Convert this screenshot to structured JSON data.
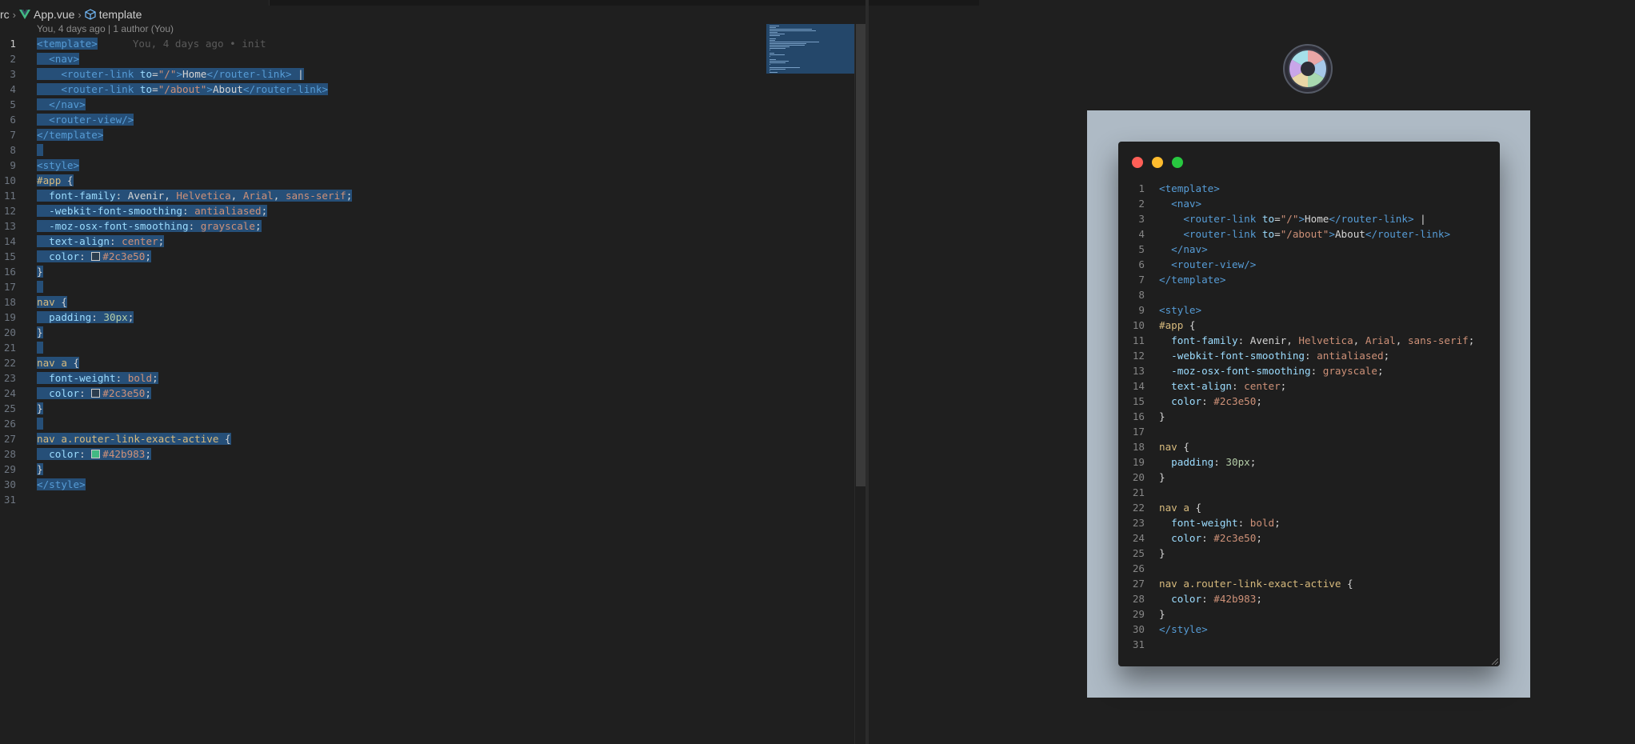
{
  "breadcrumbs": {
    "root": "rc",
    "file": "App.vue",
    "symbol": "template"
  },
  "blame": {
    "header": "You, 4 days ago | 1 author (You)",
    "inline": "You, 4 days ago • init"
  },
  "code_lines": [
    [
      {
        "t": "<template>",
        "c": "tag"
      }
    ],
    [
      {
        "t": "  ",
        "c": "text"
      },
      {
        "t": "<nav>",
        "c": "tag"
      }
    ],
    [
      {
        "t": "    ",
        "c": "text"
      },
      {
        "t": "<router-link ",
        "c": "tag"
      },
      {
        "t": "to",
        "c": "attr"
      },
      {
        "t": "=",
        "c": "punc"
      },
      {
        "t": "\"/\"",
        "c": "str"
      },
      {
        "t": ">",
        "c": "tag"
      },
      {
        "t": "Home",
        "c": "text"
      },
      {
        "t": "</router-link>",
        "c": "tag"
      },
      {
        "t": " |",
        "c": "text"
      }
    ],
    [
      {
        "t": "    ",
        "c": "text"
      },
      {
        "t": "<router-link ",
        "c": "tag"
      },
      {
        "t": "to",
        "c": "attr"
      },
      {
        "t": "=",
        "c": "punc"
      },
      {
        "t": "\"/about\"",
        "c": "str"
      },
      {
        "t": ">",
        "c": "tag"
      },
      {
        "t": "About",
        "c": "text"
      },
      {
        "t": "</router-link>",
        "c": "tag"
      }
    ],
    [
      {
        "t": "  ",
        "c": "text"
      },
      {
        "t": "</nav>",
        "c": "tag"
      }
    ],
    [
      {
        "t": "  ",
        "c": "text"
      },
      {
        "t": "<router-view/>",
        "c": "tag"
      }
    ],
    [
      {
        "t": "</template>",
        "c": "tag"
      }
    ],
    [],
    [
      {
        "t": "<style>",
        "c": "tag"
      }
    ],
    [
      {
        "t": "#app",
        "c": "sel"
      },
      {
        "t": " {",
        "c": "brace"
      }
    ],
    [
      {
        "t": "  ",
        "c": "text"
      },
      {
        "t": "font-family",
        "c": "attr"
      },
      {
        "t": ": ",
        "c": "punc"
      },
      {
        "t": "Avenir",
        "c": "text"
      },
      {
        "t": ", ",
        "c": "punc"
      },
      {
        "t": "Helvetica",
        "c": "str"
      },
      {
        "t": ", ",
        "c": "punc"
      },
      {
        "t": "Arial",
        "c": "str"
      },
      {
        "t": ", ",
        "c": "punc"
      },
      {
        "t": "sans-serif",
        "c": "str"
      },
      {
        "t": ";",
        "c": "punc"
      }
    ],
    [
      {
        "t": "  ",
        "c": "text"
      },
      {
        "t": "-webkit-font-smoothing",
        "c": "attr"
      },
      {
        "t": ": ",
        "c": "punc"
      },
      {
        "t": "antialiased",
        "c": "str"
      },
      {
        "t": ";",
        "c": "punc"
      }
    ],
    [
      {
        "t": "  ",
        "c": "text"
      },
      {
        "t": "-moz-osx-font-smoothing",
        "c": "attr"
      },
      {
        "t": ": ",
        "c": "punc"
      },
      {
        "t": "grayscale",
        "c": "str"
      },
      {
        "t": ";",
        "c": "punc"
      }
    ],
    [
      {
        "t": "  ",
        "c": "text"
      },
      {
        "t": "text-align",
        "c": "attr"
      },
      {
        "t": ": ",
        "c": "punc"
      },
      {
        "t": "center",
        "c": "str"
      },
      {
        "t": ";",
        "c": "punc"
      }
    ],
    [
      {
        "t": "  ",
        "c": "text"
      },
      {
        "t": "color",
        "c": "attr"
      },
      {
        "t": ": ",
        "c": "punc"
      },
      {
        "t": "#2c3e50",
        "c": "str",
        "swatch": "#2c3e50"
      },
      {
        "t": ";",
        "c": "punc"
      }
    ],
    [
      {
        "t": "}",
        "c": "brace"
      }
    ],
    [],
    [
      {
        "t": "nav",
        "c": "sel"
      },
      {
        "t": " {",
        "c": "brace"
      }
    ],
    [
      {
        "t": "  ",
        "c": "text"
      },
      {
        "t": "padding",
        "c": "attr"
      },
      {
        "t": ": ",
        "c": "punc"
      },
      {
        "t": "30px",
        "c": "num"
      },
      {
        "t": ";",
        "c": "punc"
      }
    ],
    [
      {
        "t": "}",
        "c": "brace"
      }
    ],
    [],
    [
      {
        "t": "nav a",
        "c": "sel"
      },
      {
        "t": " {",
        "c": "brace"
      }
    ],
    [
      {
        "t": "  ",
        "c": "text"
      },
      {
        "t": "font-weight",
        "c": "attr"
      },
      {
        "t": ": ",
        "c": "punc"
      },
      {
        "t": "bold",
        "c": "str"
      },
      {
        "t": ";",
        "c": "punc"
      }
    ],
    [
      {
        "t": "  ",
        "c": "text"
      },
      {
        "t": "color",
        "c": "attr"
      },
      {
        "t": ": ",
        "c": "punc"
      },
      {
        "t": "#2c3e50",
        "c": "str",
        "swatch": "#2c3e50"
      },
      {
        "t": ";",
        "c": "punc"
      }
    ],
    [
      {
        "t": "}",
        "c": "brace"
      }
    ],
    [],
    [
      {
        "t": "nav a.router-link-exact-active",
        "c": "sel"
      },
      {
        "t": " {",
        "c": "brace"
      }
    ],
    [
      {
        "t": "  ",
        "c": "text"
      },
      {
        "t": "color",
        "c": "attr"
      },
      {
        "t": ": ",
        "c": "punc"
      },
      {
        "t": "#42b983",
        "c": "str",
        "swatch": "#42b983"
      },
      {
        "t": ";",
        "c": "punc"
      }
    ],
    [
      {
        "t": "}",
        "c": "brace"
      }
    ],
    [
      {
        "t": "</style>",
        "c": "tag"
      }
    ],
    []
  ],
  "colors": {
    "selection": "#264f78",
    "frame_background": "#aebac5",
    "dot_close": "#ff5f57",
    "dot_minimize": "#febc2e",
    "dot_maximize": "#28c840",
    "vue_green": "#42b883",
    "vue_dark": "#35495e"
  },
  "icons": {
    "breadcrumb_separator": "chevron-right-icon",
    "file": "vue-icon",
    "symbol": "cube-icon",
    "preview_logo": "aperture-logo-icon"
  }
}
